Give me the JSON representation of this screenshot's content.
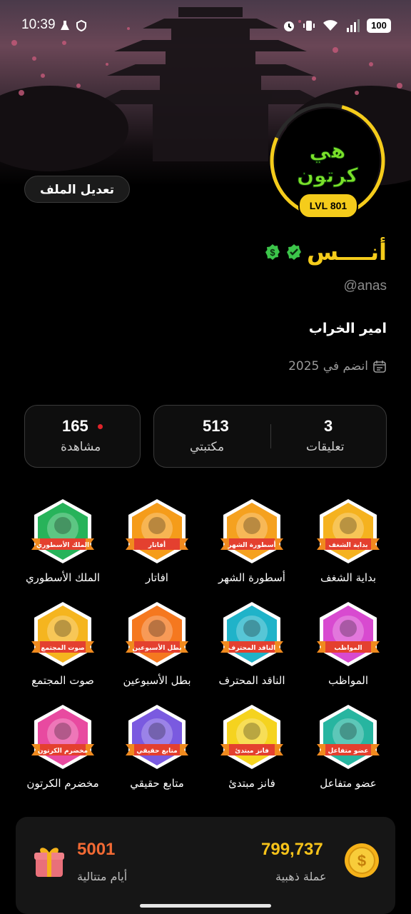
{
  "status_bar": {
    "time": "10:39",
    "battery": "100",
    "icons": [
      "flask-icon",
      "vpn-shield-icon",
      "alarm-icon",
      "vibrate-icon",
      "wifi-icon",
      "signal-4g-icon"
    ]
  },
  "profile": {
    "name": "أنــــس",
    "username": "@anas",
    "bio": "امير الخراب",
    "joined": "انضم في 2025",
    "level": "LVL 801",
    "avatar_text": "هي كرتون",
    "edit_button": "تعديل الملف",
    "accent_color": "#f5cc1b",
    "verified_color": "#3cc54a"
  },
  "stats": {
    "comments": {
      "value": "3",
      "label": "تعليقات"
    },
    "library": {
      "value": "513",
      "label": "مكتبتي"
    },
    "views": {
      "value": "165",
      "label": "مشاهدة"
    }
  },
  "badges": [
    {
      "label": "بداية الشغف",
      "ribbon": "بداية الشغف",
      "color": "#f5b21f"
    },
    {
      "label": "أسطورة الشهر",
      "ribbon": "أسطورة الشهر",
      "color": "#f5a11f"
    },
    {
      "label": "افاتار",
      "ribbon": "أفاتار",
      "color": "#f59c1a"
    },
    {
      "label": "الملك الأسطوري",
      "ribbon": "الملك الأسطوري",
      "color": "#27b35a"
    },
    {
      "label": "المواظب",
      "ribbon": "المواظب",
      "color": "#d84ad0"
    },
    {
      "label": "الناقد المحترف",
      "ribbon": "الناقد المحترف",
      "color": "#1fb3c9"
    },
    {
      "label": "بطل الأسبوعين",
      "ribbon": "بطل الأسبوعين",
      "color": "#f5781f"
    },
    {
      "label": "صوت المجتمع",
      "ribbon": "صوت المجتمع",
      "color": "#f5b51f"
    },
    {
      "label": "عضو متفاعل",
      "ribbon": "عضو متفاعل",
      "color": "#27b5a0"
    },
    {
      "label": "فانز مبتدئ",
      "ribbon": "فانز مبتدئ",
      "color": "#f5d31f"
    },
    {
      "label": "متابع حقيقي",
      "ribbon": "متابع حقيقي",
      "color": "#7a5ae0"
    },
    {
      "label": "مخضرم الكرتون",
      "ribbon": "مخضرم الكرتون",
      "color": "#e84aa0"
    }
  ],
  "wallet": {
    "coins": {
      "value": "799,737",
      "label": "عملة ذهبية"
    },
    "streak": {
      "value": "5001",
      "label": "أيام متتالية"
    }
  }
}
